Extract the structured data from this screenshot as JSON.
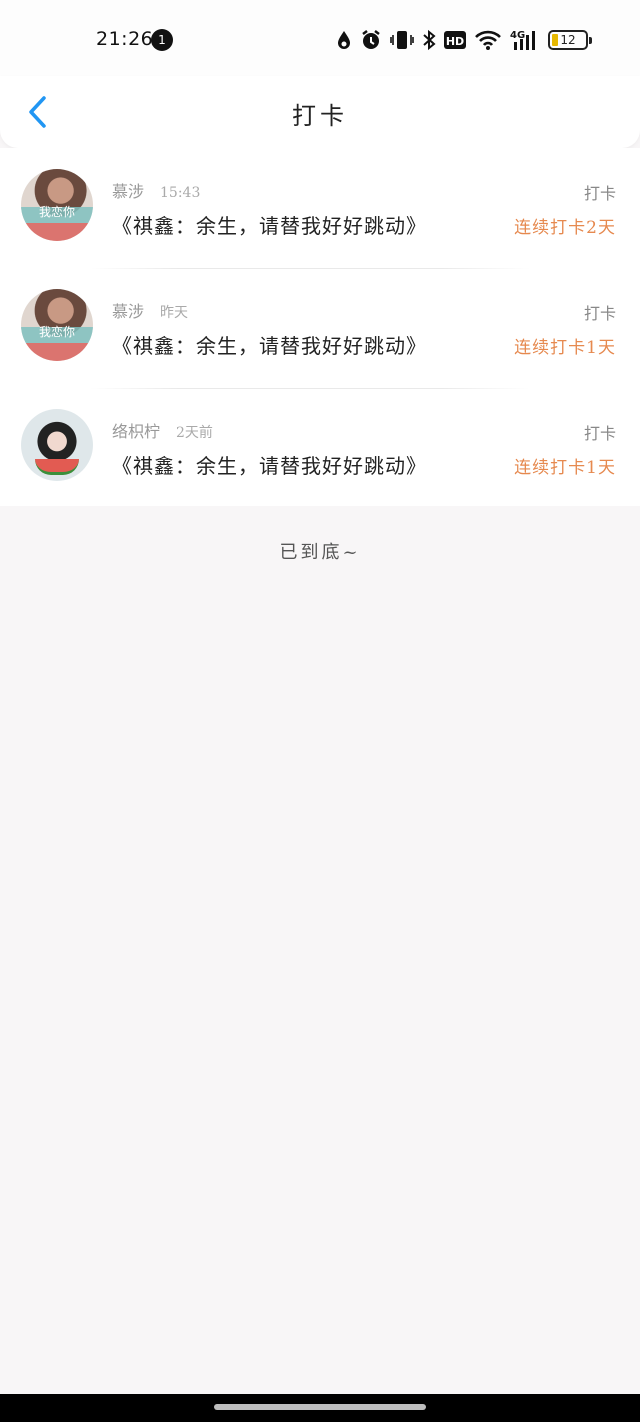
{
  "status_bar": {
    "time": "21:26",
    "notification_count": "1",
    "battery": "12",
    "icons": [
      "drop-icon",
      "alarm-icon",
      "vibrate-icon",
      "bluetooth-icon",
      "hd-icon",
      "wifi-icon",
      "4g-signal-icon",
      "battery-icon"
    ]
  },
  "header": {
    "title": "打卡"
  },
  "items": [
    {
      "author": "慕涉",
      "time": "15:43",
      "action": "打卡",
      "content": "《祺鑫：余生，请替我好好跳动》",
      "streak": "连续打卡2天",
      "avatar_tag": "我恋你"
    },
    {
      "author": "慕涉",
      "time": "昨天",
      "action": "打卡",
      "content": "《祺鑫：余生，请替我好好跳动》",
      "streak": "连续打卡1天",
      "avatar_tag": "我恋你"
    },
    {
      "author": "络枳柠",
      "time": "2天前",
      "action": "打卡",
      "content": "《祺鑫：余生，请替我好好跳动》",
      "streak": "连续打卡1天"
    }
  ],
  "footer": {
    "end_text": "已到底~"
  },
  "colors": {
    "accent": "#2196F3",
    "streak": "#E6894F",
    "background": "#F8F6F7"
  }
}
